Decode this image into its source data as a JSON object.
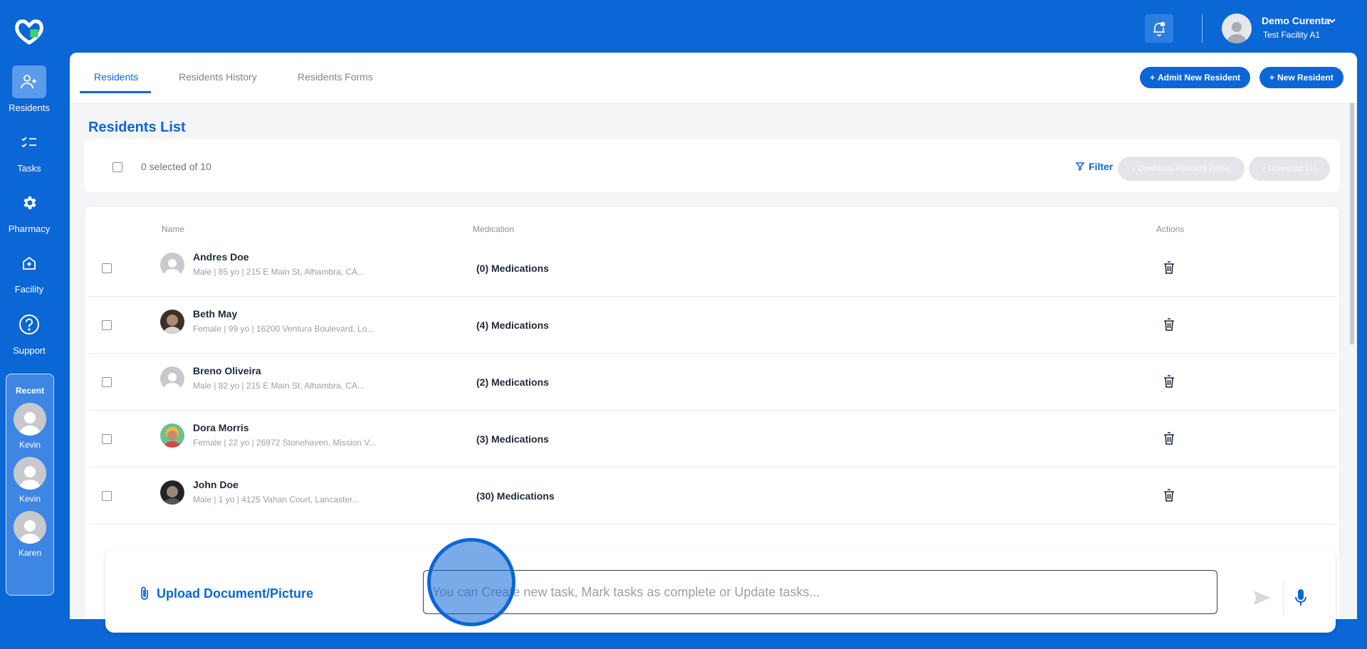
{
  "sidebar": {
    "items": [
      {
        "label": "Residents",
        "icon": "residents-icon",
        "active": true
      },
      {
        "label": "Tasks",
        "icon": "tasks-icon",
        "active": false
      },
      {
        "label": "Pharmacy",
        "icon": "gear-icon",
        "active": false
      },
      {
        "label": "Facility",
        "icon": "facility-icon",
        "active": false
      },
      {
        "label": "Support",
        "icon": "help-icon",
        "active": false
      }
    ],
    "recent": {
      "title": "Recent",
      "people": [
        "Kevin",
        "Kevin",
        "Karen"
      ]
    }
  },
  "header": {
    "user_name": "Demo Curenta",
    "facility": "Test Facility A1"
  },
  "tabs": [
    {
      "label": "Residents",
      "active": true
    },
    {
      "label": "Residents History",
      "active": false
    },
    {
      "label": "Residents Forms",
      "active": false
    }
  ],
  "actions": {
    "admit": "Admit New Resident",
    "new": "New Resident"
  },
  "list": {
    "title": "Residents List",
    "selected_text": "0 selected of 10",
    "filter": "Filter",
    "download_profile": "Download Resident Profile",
    "download_911": "Download 911",
    "columns": {
      "name": "Name",
      "medication": "Medication",
      "actions": "Actions"
    },
    "rows": [
      {
        "name": "Andres Doe",
        "meta": "Male | 85 yo | 215 E Main St, Alhambra, CA...",
        "medications": "(0) Medications",
        "photo": false
      },
      {
        "name": "Beth May",
        "meta": "Female | 99 yo | 16200 Ventura Boulevard, Lo...",
        "medications": "(4) Medications",
        "photo": true
      },
      {
        "name": "Breno Oliveira",
        "meta": "Male | 82 yo | 215 E Main St, Alhambra, CA...",
        "medications": "(2) Medications",
        "photo": false
      },
      {
        "name": "Dora Morris",
        "meta": "Female | 22 yo | 26972 Stonehaven, Mission V...",
        "medications": "(3) Medications",
        "photo": true
      },
      {
        "name": "John Doe",
        "meta": "Male | 1 yo | 4125 Vahan Court, Lancaster...",
        "medications": "(30) Medications",
        "photo": true
      }
    ]
  },
  "composer": {
    "upload_label": "Upload Document/Picture",
    "placeholder": "You can Create new task, Mark tasks as complete or Update tasks..."
  },
  "colors": {
    "brand": "#0b66d6"
  }
}
